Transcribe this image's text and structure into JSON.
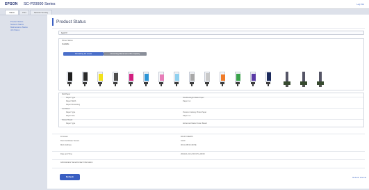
{
  "header": {
    "brand": "EPSON",
    "model": "SC-P20000 Series",
    "logout": "Log Out"
  },
  "tabs": [
    {
      "label": "Status",
      "active": true
    },
    {
      "label": "Print",
      "active": false
    },
    {
      "label": "Network Security",
      "active": false
    }
  ],
  "sidebar": {
    "items": [
      {
        "label": "Product Status"
      },
      {
        "label": "Network Status"
      },
      {
        "label": "Maintenance Status"
      },
      {
        "label": "Job Status"
      }
    ]
  },
  "main": {
    "title": "Product Status",
    "language": "English",
    "printer_status": {
      "label": "Printer Status",
      "value": "Available"
    },
    "ink_tabs": [
      {
        "label": "Remaining Ink Levels",
        "color": "#4a6fc9"
      },
      {
        "label": "Remaining Maintenance Box Capacity",
        "color": "#8a8f99"
      }
    ],
    "inks": [
      {
        "name": "Photo Black",
        "color": "#1f1f1f",
        "level": 0.95
      },
      {
        "name": "Matte Black",
        "color": "#2a2a2a",
        "level": 0.9
      },
      {
        "name": "Yellow",
        "color": "#f2e21c",
        "level": 0.8
      },
      {
        "name": "Dark Gray",
        "color": "#4d4d4d",
        "level": 0.85
      },
      {
        "name": "Magenta",
        "color": "#d21e7f",
        "level": 0.75
      },
      {
        "name": "Cyan",
        "color": "#2d95d6",
        "level": 0.8
      },
      {
        "name": "Light Magenta",
        "color": "#e77db8",
        "level": 0.7
      },
      {
        "name": "Light Cyan",
        "color": "#8fd0ef",
        "level": 0.75
      },
      {
        "name": "Gray",
        "color": "#a8a8a8",
        "level": 0.8
      },
      {
        "name": "Light Gray",
        "color": "#c9c9c9",
        "level": 0.85
      },
      {
        "name": "Orange",
        "color": "#f07b28",
        "level": 0.7
      },
      {
        "name": "Green",
        "color": "#3aa24a",
        "level": 0.8
      },
      {
        "name": "Violet",
        "color": "#5a3aa6",
        "level": 0.75
      },
      {
        "name": "Photo Black 2",
        "color": "#1c2a5c",
        "level": 0.9
      }
    ],
    "paper": {
      "roll_title": "Roll Paper",
      "roll_rows": [
        {
          "label": "Paper Type",
          "value": "Doubleweight Matte Paper"
        },
        {
          "label": "Paper Width",
          "value": "Paper cut"
        },
        {
          "label": "Paper Remaining",
          "value": ""
        }
      ],
      "cut_title": "Cut Sheet",
      "cut_rows": [
        {
          "label": "Paper Type",
          "value": "Premium Glossy Photo Paper"
        },
        {
          "label": "Paper Size",
          "value": "Paper cut"
        }
      ],
      "poster_title": "Poster Board",
      "poster_rows": [
        {
          "label": "Paper Type",
          "value": "Enhanced Matte Poster Board"
        },
        {
          "label": "Paper Size",
          "value": ""
        }
      ]
    },
    "info_rows": [
      {
        "label": "Firmware",
        "value": "BX1KTX0EBT3"
      },
      {
        "label": "Root Certificate Version",
        "value": "01.00"
      },
      {
        "label": "MAC Address",
        "value": "00:1A:2B:3C:4D:5E"
      }
    ],
    "datetime": {
      "label": "Date and Time",
      "value": "2024-01-01 12:00 UTC+00:00"
    },
    "admin_contact": "Administrator Name/Contact Information",
    "refresh_button": "Refresh",
    "refresh_link": "Refresh Interval"
  }
}
